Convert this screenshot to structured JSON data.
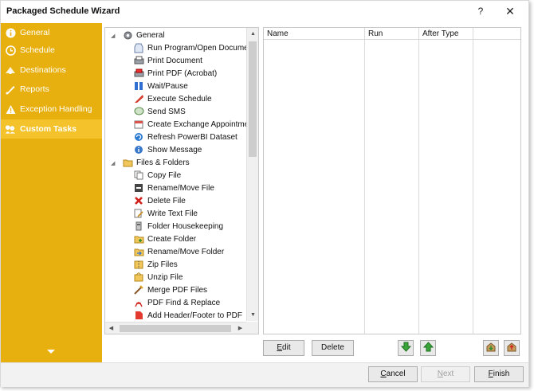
{
  "window": {
    "title": "Packaged Schedule Wizard",
    "help": "?",
    "close": "✕"
  },
  "colors": {
    "sidebar_bg": "#e8b00e",
    "sidebar_active": "#f4c22a"
  },
  "sidebar": {
    "items": [
      {
        "label": "General",
        "icon": "info-icon"
      },
      {
        "label": "Schedule",
        "icon": "clock-icon"
      },
      {
        "label": "Destinations",
        "icon": "destinations-icon"
      },
      {
        "label": "Reports",
        "icon": "reports-icon"
      },
      {
        "label": "Exception Handling",
        "icon": "warning-icon"
      },
      {
        "label": "Custom Tasks",
        "icon": "custom-tasks-icon",
        "active": true
      }
    ]
  },
  "tree": {
    "groups": [
      {
        "label": "General",
        "icon": "gear-icon",
        "items": [
          {
            "label": "Run Program/Open Document",
            "icon": "run-program-icon"
          },
          {
            "label": "Print Document",
            "icon": "printer-icon"
          },
          {
            "label": "Print PDF (Acrobat)",
            "icon": "print-pdf-icon"
          },
          {
            "label": "Wait/Pause",
            "icon": "pause-icon"
          },
          {
            "label": "Execute Schedule",
            "icon": "execute-schedule-icon"
          },
          {
            "label": "Send SMS",
            "icon": "sms-icon"
          },
          {
            "label": "Create Exchange Appointment",
            "icon": "calendar-icon"
          },
          {
            "label": "Refresh PowerBI Dataset",
            "icon": "refresh-icon"
          },
          {
            "label": "Show Message",
            "icon": "message-info-icon"
          }
        ]
      },
      {
        "label": "Files & Folders",
        "icon": "folder-icon",
        "items": [
          {
            "label": "Copy File",
            "icon": "copy-file-icon"
          },
          {
            "label": "Rename/Move File",
            "icon": "rename-file-icon"
          },
          {
            "label": "Delete File",
            "icon": "delete-icon"
          },
          {
            "label": "Write Text File",
            "icon": "write-text-icon"
          },
          {
            "label": "Folder Housekeeping",
            "icon": "housekeeping-icon"
          },
          {
            "label": "Create Folder",
            "icon": "create-folder-icon"
          },
          {
            "label": "Rename/Move Folder",
            "icon": "move-folder-icon"
          },
          {
            "label": "Zip Files",
            "icon": "zip-icon"
          },
          {
            "label": "Unzip File",
            "icon": "unzip-icon"
          },
          {
            "label": "Merge PDF Files",
            "icon": "merge-pdf-icon"
          },
          {
            "label": "PDF Find & Replace",
            "icon": "pdf-find-icon"
          },
          {
            "label": "Add Header/Footer to PDF",
            "icon": "pdf-header-icon"
          }
        ]
      }
    ]
  },
  "grid": {
    "columns": [
      "Name",
      "Run",
      "After Type"
    ]
  },
  "actions": {
    "edit": "Edit",
    "edit_mn": "E",
    "edit_rest": "dit",
    "delete": "Delete"
  },
  "footer": {
    "cancel_mn": "C",
    "cancel_rest": "ancel",
    "next_mn": "N",
    "next_rest": "ext",
    "finish_mn": "F",
    "finish_rest": "inish"
  }
}
